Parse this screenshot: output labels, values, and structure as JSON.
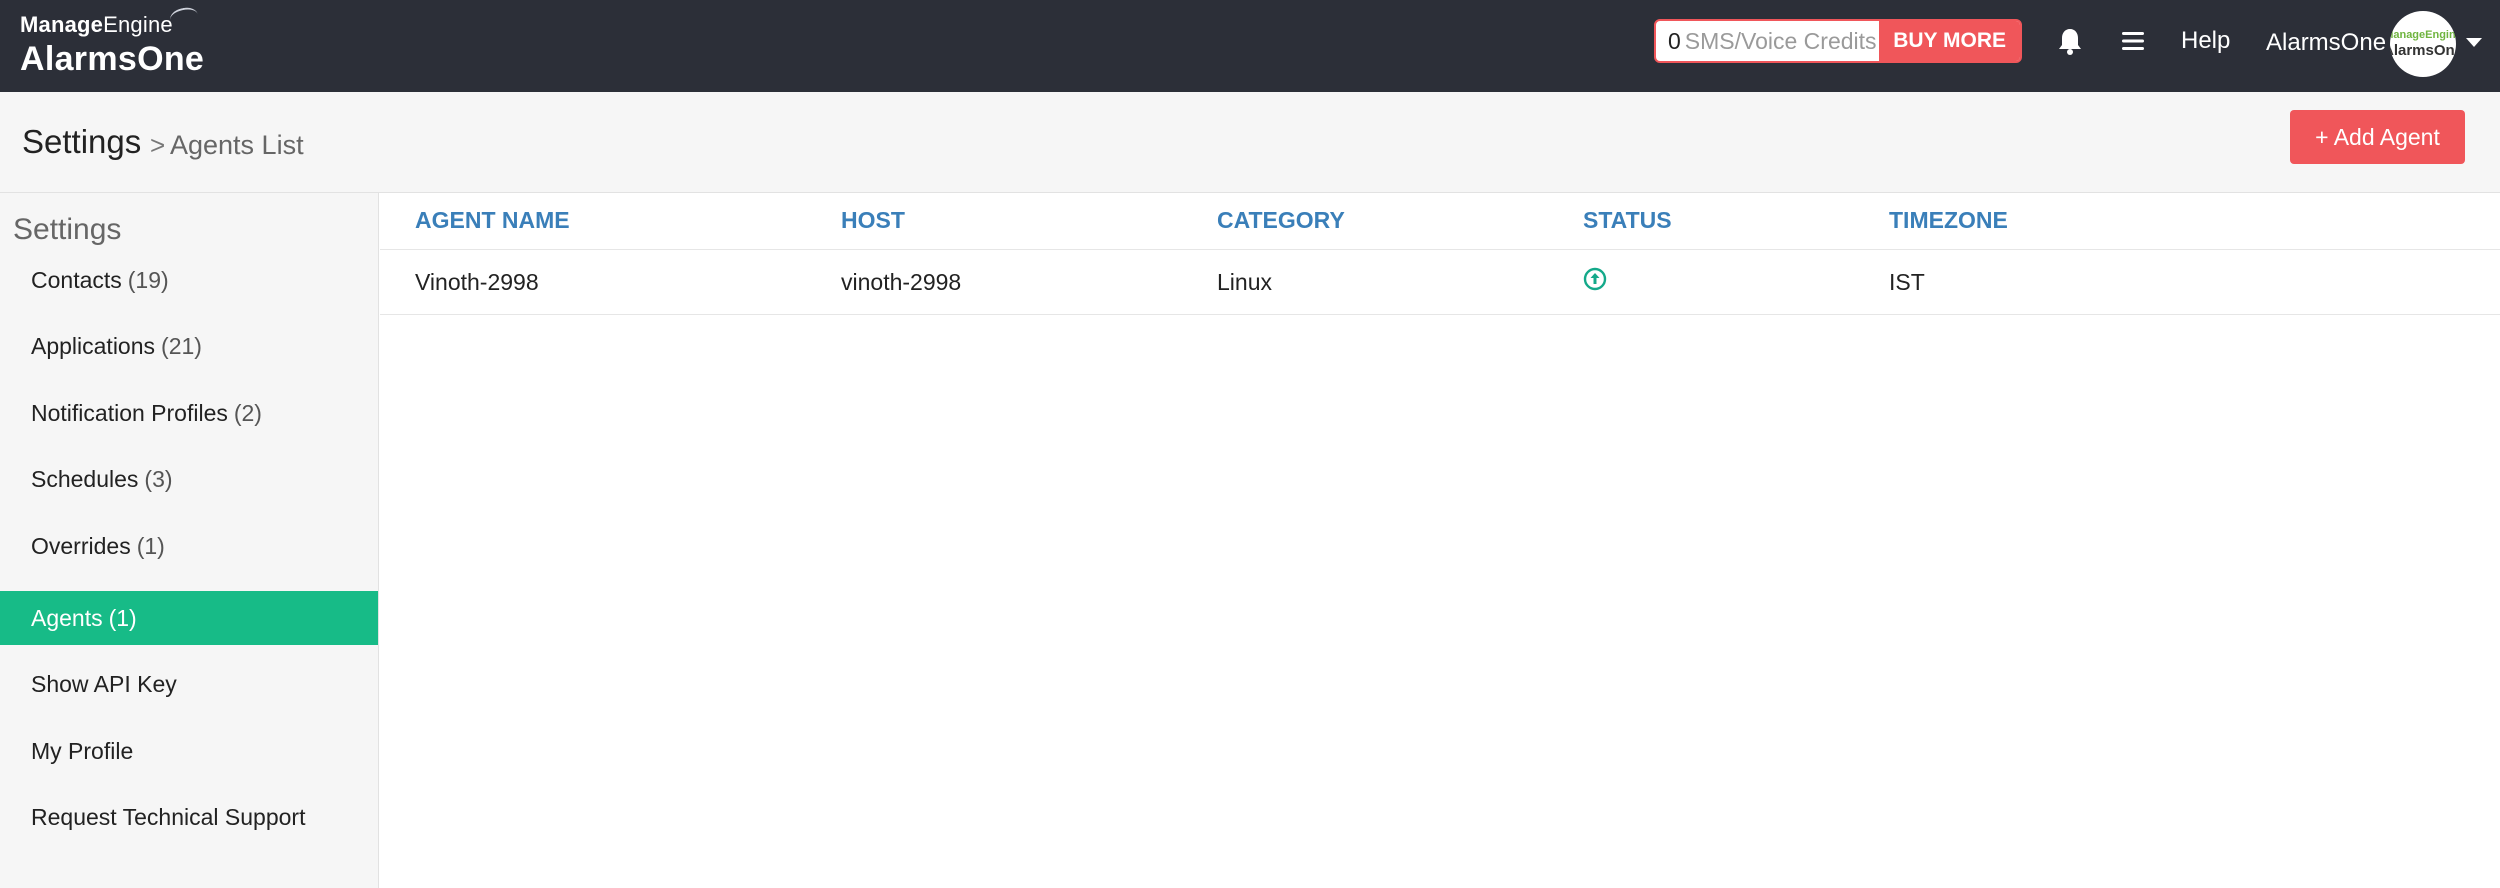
{
  "brand": {
    "vendor_bold": "Manage",
    "vendor_thin": "Engine",
    "product": "AlarmsOne"
  },
  "topbar": {
    "credits_count": "0",
    "credits_label": "SMS/Voice Credits",
    "buy_more": "BUY MORE",
    "help": "Help",
    "username": "AlarmsOne",
    "avatar_line1": "ManageEngine",
    "avatar_line2": "AlarmsOne",
    "icons": [
      "bell-icon",
      "hamburger-menu-icon",
      "caret-down-icon"
    ]
  },
  "breadcrumb": {
    "root": "Settings",
    "separator": ">",
    "leaf": "Agents List"
  },
  "actions": {
    "add_agent": "+ Add Agent"
  },
  "sidebar": {
    "title": "Settings",
    "items": [
      {
        "label": "Contacts",
        "count": "(19)"
      },
      {
        "label": "Applications",
        "count": "(21)"
      },
      {
        "label": "Notification Profiles",
        "count": "(2)"
      },
      {
        "label": "Schedules",
        "count": "(3)"
      },
      {
        "label": "Overrides",
        "count": "(1)"
      },
      {
        "label": "Agents",
        "count": "(1)",
        "active": true
      },
      {
        "label": "Show API Key",
        "count": ""
      },
      {
        "label": "My Profile",
        "count": ""
      },
      {
        "label": "Request Technical Support",
        "count": ""
      }
    ]
  },
  "table": {
    "columns": [
      "AGENT NAME",
      "HOST",
      "CATEGORY",
      "STATUS",
      "TIMEZONE"
    ],
    "rows": [
      {
        "agent_name": "Vinoth-2998",
        "host": "vinoth-2998",
        "category": "Linux",
        "status_icon": "status-up-icon",
        "timezone": "IST"
      }
    ]
  },
  "colors": {
    "topbar_bg": "#2c2f38",
    "accent_red": "#f0565a",
    "active_green": "#17bb87",
    "header_blue": "#3a7fb9",
    "status_teal": "#14a98a"
  }
}
